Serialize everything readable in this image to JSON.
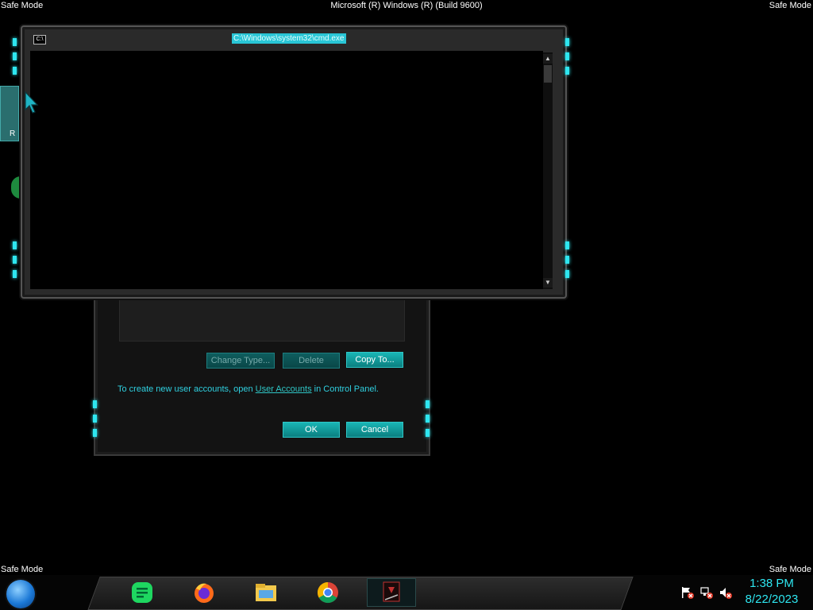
{
  "safe_mode_label": "Safe Mode",
  "build_info": "Microsoft (R) Windows (R) (Build 9600)",
  "desktop": {
    "icon_label": "R"
  },
  "cmd_window": {
    "title": "C:\\Windows\\system32\\cmd.exe",
    "icon_text": "C:\\",
    "scroll_up": "▲",
    "scroll_down": "▼"
  },
  "dialog": {
    "buttons": {
      "change_type": "Change Type...",
      "delete": "Delete",
      "copy_to": "Copy To...",
      "ok": "OK",
      "cancel": "Cancel"
    },
    "message_prefix": "To create new user accounts, open ",
    "message_link": "User Accounts",
    "message_suffix": " in Control Panel."
  },
  "taskbar": {
    "icons": [
      "start-orb",
      "chat-icon",
      "firefox-icon",
      "file-explorer-icon",
      "chrome-icon",
      "cmd-icon"
    ],
    "tray_icons": [
      "action-center-flag-icon",
      "network-icon",
      "volume-muted-icon"
    ],
    "clock_time": "1:38 PM",
    "clock_date": "8/22/2023"
  },
  "colors": {
    "accent": "#2ee6f0",
    "button": "#14a3a4",
    "title_highlight": "#29c6d6"
  }
}
